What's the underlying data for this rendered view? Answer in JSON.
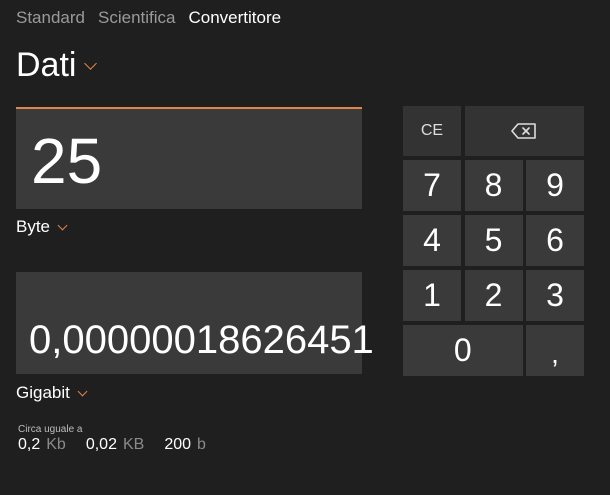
{
  "tabs": [
    {
      "label": "Standard",
      "active": false
    },
    {
      "label": "Scientifica",
      "active": false
    },
    {
      "label": "Convertitore",
      "active": true
    }
  ],
  "category": {
    "label": "Dati",
    "icon": "chevron-down-icon"
  },
  "input": {
    "value": "25",
    "unit": "Byte"
  },
  "output": {
    "value": "0,00000018626451",
    "unit": "Gigabit"
  },
  "approx": {
    "title": "Circa uguale a",
    "items": [
      {
        "value": "0,2",
        "unit": "Kb"
      },
      {
        "value": "0,02",
        "unit": "KB"
      },
      {
        "value": "200",
        "unit": "b"
      }
    ]
  },
  "keypad": {
    "ce": "CE",
    "backspace_icon": "backspace-icon",
    "digits": [
      "7",
      "8",
      "9",
      "4",
      "5",
      "6",
      "1",
      "2",
      "3"
    ],
    "zero": "0",
    "comma": ","
  },
  "colors": {
    "accent": "#e0854a",
    "background": "#1f1f1f",
    "panel": "#3a3a3a"
  }
}
